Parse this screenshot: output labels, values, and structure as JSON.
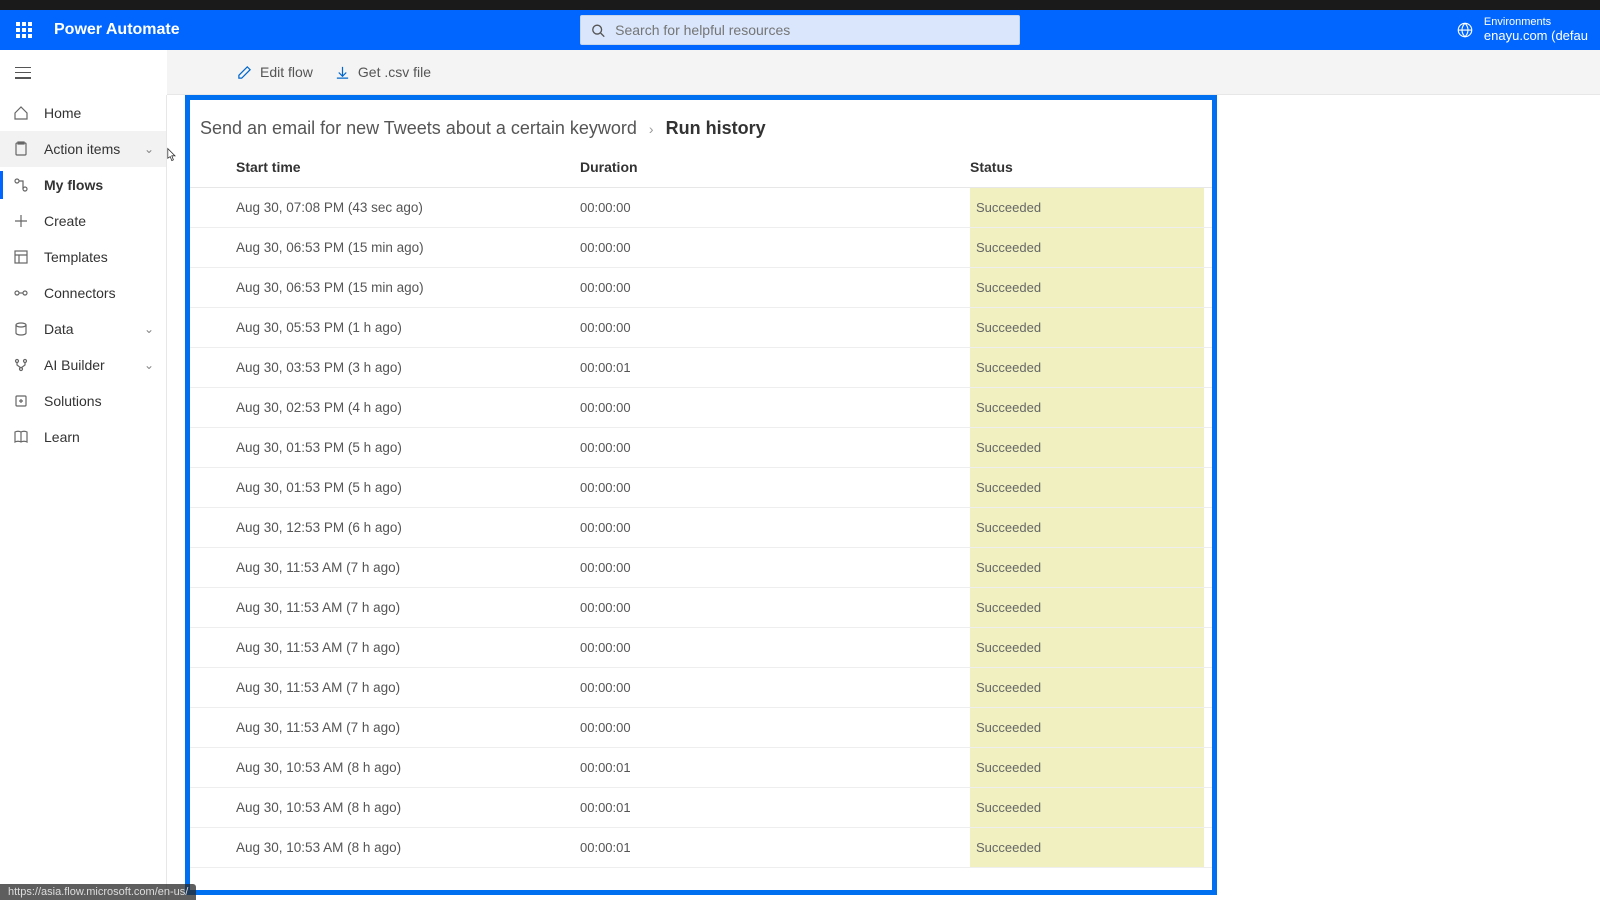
{
  "header": {
    "brand": "Power Automate",
    "search_placeholder": "Search for helpful resources",
    "env_label": "Environments",
    "env_name": "enayu.com (defau"
  },
  "toolbar": {
    "edit_flow": "Edit flow",
    "get_csv": "Get .csv file"
  },
  "sidebar": {
    "items": [
      {
        "label": "Home"
      },
      {
        "label": "Action items"
      },
      {
        "label": "My flows"
      },
      {
        "label": "Create"
      },
      {
        "label": "Templates"
      },
      {
        "label": "Connectors"
      },
      {
        "label": "Data"
      },
      {
        "label": "AI Builder"
      },
      {
        "label": "Solutions"
      },
      {
        "label": "Learn"
      }
    ]
  },
  "breadcrumb": {
    "flow_name": "Send an email for new Tweets about a certain keyword",
    "current": "Run history"
  },
  "table": {
    "headers": {
      "start": "Start time",
      "duration": "Duration",
      "status": "Status"
    },
    "rows": [
      {
        "start": "Aug 30, 07:08 PM (43 sec ago)",
        "duration": "00:00:00",
        "status": "Succeeded"
      },
      {
        "start": "Aug 30, 06:53 PM (15 min ago)",
        "duration": "00:00:00",
        "status": "Succeeded"
      },
      {
        "start": "Aug 30, 06:53 PM (15 min ago)",
        "duration": "00:00:00",
        "status": "Succeeded"
      },
      {
        "start": "Aug 30, 05:53 PM (1 h ago)",
        "duration": "00:00:00",
        "status": "Succeeded"
      },
      {
        "start": "Aug 30, 03:53 PM (3 h ago)",
        "duration": "00:00:01",
        "status": "Succeeded"
      },
      {
        "start": "Aug 30, 02:53 PM (4 h ago)",
        "duration": "00:00:00",
        "status": "Succeeded"
      },
      {
        "start": "Aug 30, 01:53 PM (5 h ago)",
        "duration": "00:00:00",
        "status": "Succeeded"
      },
      {
        "start": "Aug 30, 01:53 PM (5 h ago)",
        "duration": "00:00:00",
        "status": "Succeeded"
      },
      {
        "start": "Aug 30, 12:53 PM (6 h ago)",
        "duration": "00:00:00",
        "status": "Succeeded"
      },
      {
        "start": "Aug 30, 11:53 AM (7 h ago)",
        "duration": "00:00:00",
        "status": "Succeeded"
      },
      {
        "start": "Aug 30, 11:53 AM (7 h ago)",
        "duration": "00:00:00",
        "status": "Succeeded"
      },
      {
        "start": "Aug 30, 11:53 AM (7 h ago)",
        "duration": "00:00:00",
        "status": "Succeeded"
      },
      {
        "start": "Aug 30, 11:53 AM (7 h ago)",
        "duration": "00:00:00",
        "status": "Succeeded"
      },
      {
        "start": "Aug 30, 11:53 AM (7 h ago)",
        "duration": "00:00:00",
        "status": "Succeeded"
      },
      {
        "start": "Aug 30, 10:53 AM (8 h ago)",
        "duration": "00:00:01",
        "status": "Succeeded"
      },
      {
        "start": "Aug 30, 10:53 AM (8 h ago)",
        "duration": "00:00:01",
        "status": "Succeeded"
      },
      {
        "start": "Aug 30, 10:53 AM (8 h ago)",
        "duration": "00:00:01",
        "status": "Succeeded"
      }
    ]
  },
  "url_hint": "https://asia.flow.microsoft.com/en-us/"
}
